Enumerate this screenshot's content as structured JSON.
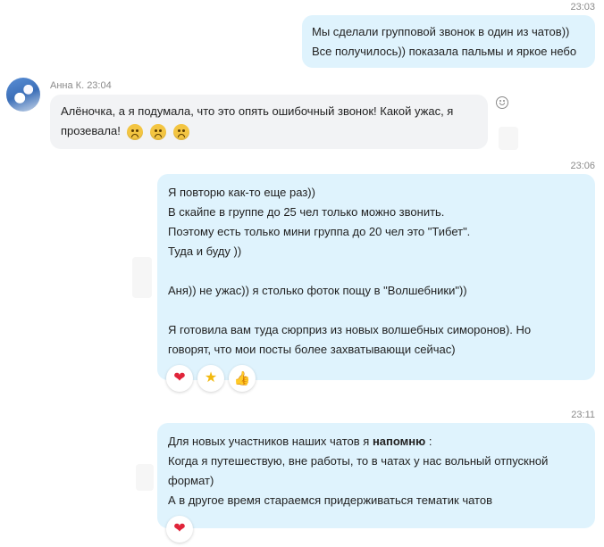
{
  "messages": [
    {
      "id": "m1",
      "time": "23:03",
      "lines": [
        "Мы сделали групповой звонок в один из чатов))",
        "Все получилось)) показала пальмы и яркое небо"
      ]
    },
    {
      "id": "m2",
      "author": "Анна К.",
      "time": "23:04",
      "lines": [
        "Алёночка, а я подумала, что это опять ошибочный звонок! Какой ужас, я",
        "прозевала!"
      ],
      "emojis": [
        "sad-face-emoji",
        "sad-face-emoji",
        "sad-face-emoji"
      ]
    },
    {
      "id": "m3",
      "time": "23:06",
      "lines": [
        "Я повторю как-то еще раз))",
        "В скайпе в группе до 25 чел только можно звонить.",
        "Поэтому есть только мини группа до 20 чел это \"Тибет\".",
        "Туда и буду ))",
        "",
        "Аня)) не ужас)) я столько фоток пощу в \"Волшебники\"))",
        "",
        "Я готовила вам туда сюрприз из новых волшебных симоронов). Но",
        "говорят, что мои посты более захватывающи сейчас)"
      ],
      "reactions": [
        "heart-icon",
        "star-icon",
        "thumbs-up-icon"
      ]
    },
    {
      "id": "m4",
      "time": "23:11",
      "line1_prefix": "Для новых участников наших чатов я ",
      "line1_bold": "напомню",
      "line1_suffix": " :",
      "lines": [
        "Когда я путешествую, вне работы, то в чатах у нас вольный отпускной",
        "формат)",
        "А в другое время стараемся придерживаться тематик чатов"
      ],
      "reactions": [
        "heart-icon"
      ]
    }
  ],
  "colors": {
    "outgoing_bubble": "#dff3fd",
    "incoming_bubble": "#f2f3f5",
    "timestamp": "#8a8a8a"
  }
}
